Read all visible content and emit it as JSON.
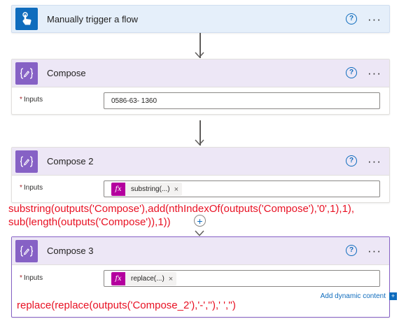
{
  "trigger": {
    "title": "Manually trigger a flow",
    "help_icon": "?",
    "more_icon": "···"
  },
  "compose1": {
    "title": "Compose",
    "inputs_label": "Inputs",
    "required_mark": "*",
    "input_value": "0586-63- 1360",
    "help_icon": "?",
    "more_icon": "···"
  },
  "compose2": {
    "title": "Compose 2",
    "inputs_label": "Inputs",
    "required_mark": "*",
    "token_label": "substring(...)",
    "token_fx": "fx",
    "token_close": "×",
    "help_icon": "?",
    "more_icon": "···"
  },
  "compose3": {
    "title": "Compose 3",
    "inputs_label": "Inputs",
    "required_mark": "*",
    "token_label": "replace(...)",
    "token_fx": "fx",
    "token_close": "×",
    "help_icon": "?",
    "more_icon": "···",
    "dynamic_link": "Add dynamic content",
    "dynamic_icon": "+"
  },
  "annotations": {
    "substring_line1": "substring(outputs('Compose'),add(nthIndexOf(outputs('Compose'),'0',1),1),",
    "substring_line2": "sub(length(outputs('Compose')),1))",
    "replace_expr": "replace(replace(outputs('Compose_2'),'-',''),' ','')"
  },
  "insert_step_icon": "+",
  "colors": {
    "trigger_header": "#e5effa",
    "trigger_icon": "#0f6cbd",
    "compose_header": "#ede7f6",
    "compose_icon": "#8661c5",
    "token_fx": "#b4009e",
    "annotation": "#e81123",
    "link": "#0f6cbd"
  }
}
